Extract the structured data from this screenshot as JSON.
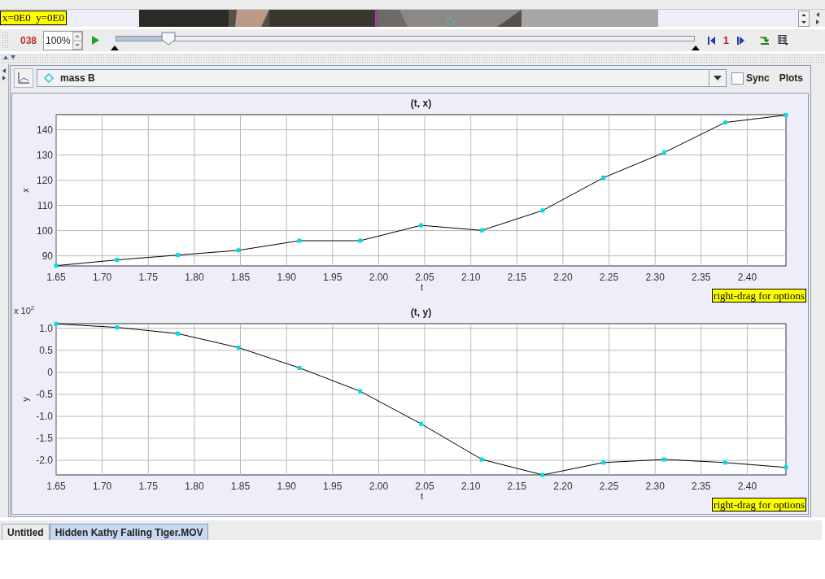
{
  "video_strip": {
    "coordinates": "x=0E0  y=0E0"
  },
  "player": {
    "frame": "038",
    "rate": "100%",
    "slider": {
      "level": 0.09
    },
    "step_size": "1"
  },
  "track_panel": {
    "track": "mass B",
    "sync": {
      "label": "Sync",
      "checked": false
    },
    "plots_button": "Plots",
    "plots": [
      {
        "hint": "right-drag for options",
        "chart_data": {
          "type": "line",
          "title": "(t, x)",
          "xlabel": "t",
          "ylabel": "x",
          "x": [
            1.65,
            1.716,
            1.782,
            1.848,
            1.914,
            1.98,
            2.046,
            2.112,
            2.178,
            2.244,
            2.31,
            2.376,
            2.442
          ],
          "grid": true,
          "series": [
            {
              "color": "#00e0e0",
              "marker": "square",
              "values": [
                86.1,
                88.4,
                90.3,
                92.2,
                96,
                96,
                102.1,
                100.1,
                108,
                121,
                131,
                142.9,
                145.8
              ]
            }
          ],
          "xlim": [
            1.65,
            2.442
          ],
          "ylim": [
            86,
            146
          ],
          "xticks": [
            1.65,
            {
              "value": 1.7,
              "label": "1.70"
            },
            1.75,
            {
              "value": 1.8,
              "label": "1.80"
            },
            1.85,
            {
              "value": 1.9,
              "label": "1.90"
            },
            1.95,
            {
              "value": 2.0,
              "label": "2.00"
            },
            2.05,
            {
              "value": 2.1,
              "label": "2.10"
            },
            2.15,
            {
              "value": 2.2,
              "label": "2.20"
            },
            2.25,
            {
              "value": 2.3,
              "label": "2.30"
            },
            2.35,
            {
              "value": 2.4,
              "label": "2.40"
            }
          ],
          "yticks": [
            90,
            100,
            110,
            120,
            130,
            140
          ]
        }
      },
      {
        "hint": "right-drag for options",
        "chart_data": {
          "type": "line",
          "title": "(t, y)",
          "xlabel": "t",
          "ylabel": "y",
          "x": [
            1.65,
            1.716,
            1.782,
            1.848,
            1.914,
            1.98,
            2.046,
            2.112,
            2.178,
            2.244,
            2.31,
            2.376,
            2.442
          ],
          "grid": true,
          "series": [
            {
              "color": "#00e0e0",
              "marker": "square",
              "values": [
                1.1,
                1.02,
                0.88,
                0.56,
                0.1,
                -0.43,
                -1.17,
                -1.98,
                -2.33,
                -2.05,
                -1.98,
                -2.05,
                -2.16
              ]
            }
          ],
          "xlim": [
            1.65,
            2.442
          ],
          "ylim": [
            -2.33,
            1.105
          ],
          "xticks": [
            1.65,
            {
              "value": 1.7,
              "label": "1.70"
            },
            1.75,
            {
              "value": 1.8,
              "label": "1.80"
            },
            1.85,
            {
              "value": 1.9,
              "label": "1.90"
            },
            1.95,
            {
              "value": 2.0,
              "label": "2.00"
            },
            2.05,
            {
              "value": 2.1,
              "label": "2.10"
            },
            2.15,
            {
              "value": 2.2,
              "label": "2.20"
            },
            2.25,
            {
              "value": 2.3,
              "label": "2.30"
            },
            2.35,
            {
              "value": 2.4,
              "label": "2.40"
            }
          ],
          "yticks": [
            {
              "value": 1.0,
              "label": "1.0"
            },
            0.5,
            0,
            -0.5,
            {
              "value": -1.0,
              "label": "-1.0"
            },
            -1.5,
            {
              "value": -2.0,
              "label": "-2.0"
            }
          ],
          "annotations": [
            {
              "text": "x 10$^{2}$"
            }
          ]
        }
      }
    ]
  },
  "tabs": [
    {
      "label": "Untitled",
      "selected": false
    },
    {
      "label": "Hidden Kathy Falling Tiger.MOV",
      "selected": true
    }
  ]
}
